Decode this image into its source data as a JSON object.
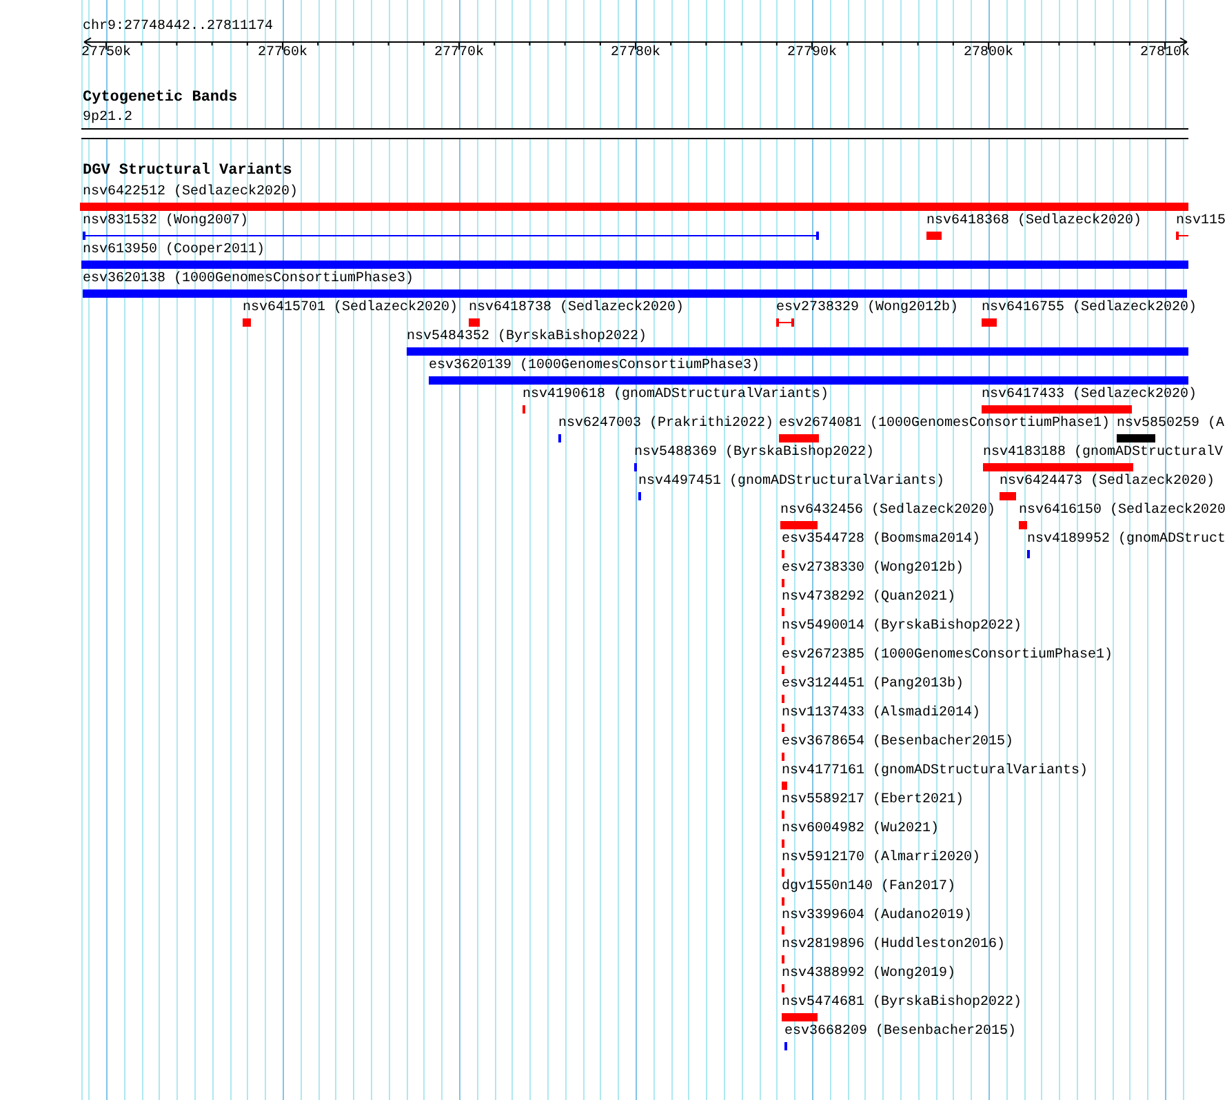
{
  "ruler": {
    "region": "chr9:27748442..27811174",
    "ticks": [
      "27750k",
      "27760k",
      "27770k",
      "27780k",
      "27790k",
      "27800k",
      "27810k"
    ]
  },
  "tracks": [
    {
      "kind": "cytoband",
      "title": "Cytogenetic Bands",
      "bands": [
        {
          "name": "9p21.2"
        }
      ]
    },
    {
      "kind": "features",
      "title": "DGV Structural Variants",
      "features": [
        {
          "label": "nsv6422512 (Sedlazeck2020)",
          "color": "#ff0000",
          "kind": "block"
        },
        {
          "label": "nsv831532 (Wong2007)",
          "color": "#0000ff",
          "kind": "span"
        },
        {
          "label": "nsv6418368 (Sedlazeck2020)",
          "color": "#ff0000",
          "kind": "block"
        },
        {
          "label": "nsv115",
          "color": "#ff0000",
          "kind": "span"
        },
        {
          "label": "nsv613950 (Cooper2011)",
          "color": "#0000ff",
          "kind": "block"
        },
        {
          "label": "esv3620138 (1000GenomesConsortiumPhase3)",
          "color": "#0000ff",
          "kind": "block"
        },
        {
          "label": "nsv6415701 (Sedlazeck2020)",
          "color": "#ff0000",
          "kind": "block"
        },
        {
          "label": "nsv6418738 (Sedlazeck2020)",
          "color": "#ff0000",
          "kind": "block"
        },
        {
          "label": "esv2738329 (Wong2012b)",
          "color": "#ff0000",
          "kind": "span"
        },
        {
          "label": "nsv6416755 (Sedlazeck2020)",
          "color": "#ff0000",
          "kind": "block"
        },
        {
          "label": "nsv5484352 (ByrskaBishop2022)",
          "color": "#0000ff",
          "kind": "block"
        },
        {
          "label": "esv3620139 (1000GenomesConsortiumPhase3)",
          "color": "#0000ff",
          "kind": "block"
        },
        {
          "label": "nsv4190618 (gnomADStructuralVariants)",
          "color": "#ff0000",
          "kind": "block"
        },
        {
          "label": "nsv6417433 (Sedlazeck2020)",
          "color": "#ff0000",
          "kind": "block"
        },
        {
          "label": "nsv6247003 (Prakrithi2022)",
          "color": "#0000ff",
          "kind": "block"
        },
        {
          "label": "esv2674081 (1000GenomesConsortiumPhase1)",
          "color": "#ff0000",
          "kind": "block"
        },
        {
          "label": "nsv5850259 (A",
          "color": "#000000",
          "kind": "block"
        },
        {
          "label": "nsv5488369 (ByrskaBishop2022)",
          "color": "#0000ff",
          "kind": "block"
        },
        {
          "label": "nsv4183188 (gnomADStructuralV",
          "color": "#ff0000",
          "kind": "block"
        },
        {
          "label": "nsv4497451 (gnomADStructuralVariants)",
          "color": "#0000ff",
          "kind": "block"
        },
        {
          "label": "nsv6424473 (Sedlazeck2020)",
          "color": "#ff0000",
          "kind": "block"
        },
        {
          "label": "nsv6432456 (Sedlazeck2020)",
          "color": "#ff0000",
          "kind": "block"
        },
        {
          "label": "nsv6416150 (Sedlazeck2020",
          "color": "#ff0000",
          "kind": "block"
        },
        {
          "label": "esv3544728 (Boomsma2014)",
          "color": "#ff0000",
          "kind": "block"
        },
        {
          "label": "nsv4189952 (gnomADStruct",
          "color": "#0000ff",
          "kind": "block"
        },
        {
          "label": "esv2738330 (Wong2012b)",
          "color": "#ff0000",
          "kind": "block"
        },
        {
          "label": "nsv4738292 (Quan2021)",
          "color": "#ff0000",
          "kind": "block"
        },
        {
          "label": "nsv5490014 (ByrskaBishop2022)",
          "color": "#ff0000",
          "kind": "block"
        },
        {
          "label": "esv2672385 (1000GenomesConsortiumPhase1)",
          "color": "#ff0000",
          "kind": "block"
        },
        {
          "label": "esv3124451 (Pang2013b)",
          "color": "#ff0000",
          "kind": "block"
        },
        {
          "label": "nsv1137433 (Alsmadi2014)",
          "color": "#ff0000",
          "kind": "block"
        },
        {
          "label": "esv3678654 (Besenbacher2015)",
          "color": "#ff0000",
          "kind": "block"
        },
        {
          "label": "nsv4177161 (gnomADStructuralVariants)",
          "color": "#ff0000",
          "kind": "block"
        },
        {
          "label": "nsv5589217 (Ebert2021)",
          "color": "#ff0000",
          "kind": "block"
        },
        {
          "label": "nsv6004982 (Wu2021)",
          "color": "#ff0000",
          "kind": "block"
        },
        {
          "label": "nsv5912170 (Almarri2020)",
          "color": "#ff0000",
          "kind": "block"
        },
        {
          "label": "dgv1550n140 (Fan2017)",
          "color": "#ff0000",
          "kind": "block"
        },
        {
          "label": "nsv3399604 (Audano2019)",
          "color": "#ff0000",
          "kind": "block"
        },
        {
          "label": "nsv2819896 (Huddleston2016)",
          "color": "#ff0000",
          "kind": "block"
        },
        {
          "label": "nsv4388992 (Wong2019)",
          "color": "#ff0000",
          "kind": "block"
        },
        {
          "label": "nsv5474681 (ByrskaBishop2022)",
          "color": "#ff0000",
          "kind": "block"
        },
        {
          "label": "esv3668209 (Besenbacher2015)",
          "color": "#0000ff",
          "kind": "block"
        }
      ]
    }
  ]
}
